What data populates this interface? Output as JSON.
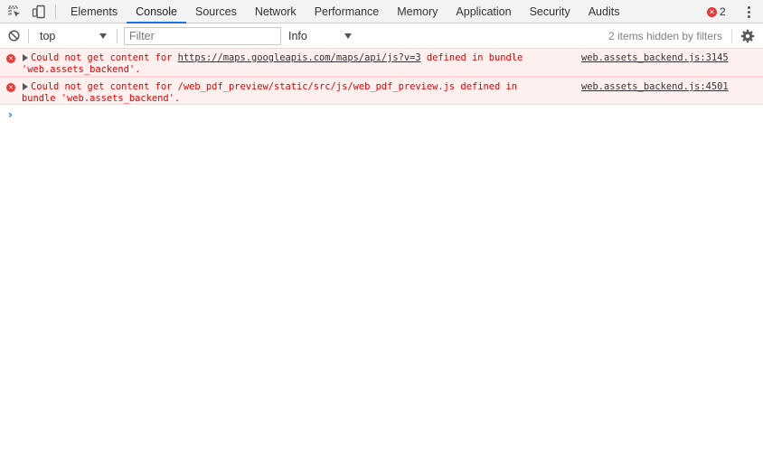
{
  "tabs": [
    {
      "label": "Elements"
    },
    {
      "label": "Console",
      "active": true
    },
    {
      "label": "Sources"
    },
    {
      "label": "Network"
    },
    {
      "label": "Performance"
    },
    {
      "label": "Memory"
    },
    {
      "label": "Application"
    },
    {
      "label": "Security"
    },
    {
      "label": "Audits"
    }
  ],
  "error_count": "2",
  "toolbar": {
    "context": "top",
    "filter_placeholder": "Filter",
    "level": "Info",
    "hidden_info": "2 items hidden by filters"
  },
  "messages": [
    {
      "prefix": "Could not get content for ",
      "link": "https://maps.googleapis.com/maps/api/js?v=3",
      "suffix": " defined in bundle",
      "line2": "'web.assets_backend'.",
      "source": "web.assets_backend.js:3145"
    },
    {
      "prefix": "Could not get content for /web_pdf_preview/static/src/js/web_pdf_preview.js defined in",
      "link": "",
      "suffix": "",
      "line2": "bundle 'web.assets_backend'.",
      "source": "web.assets_backend.js:4501"
    }
  ],
  "colors": {
    "accent": "#1a73e8",
    "error": "#e53935",
    "error_text": "#e00000",
    "error_bg": "#fff0f0"
  },
  "icons": [
    "inspect-icon",
    "device-toggle-icon",
    "error-icon",
    "more-icon",
    "clear-console-icon",
    "settings-icon",
    "expand-triangle-icon",
    "prompt-chevron-icon"
  ]
}
